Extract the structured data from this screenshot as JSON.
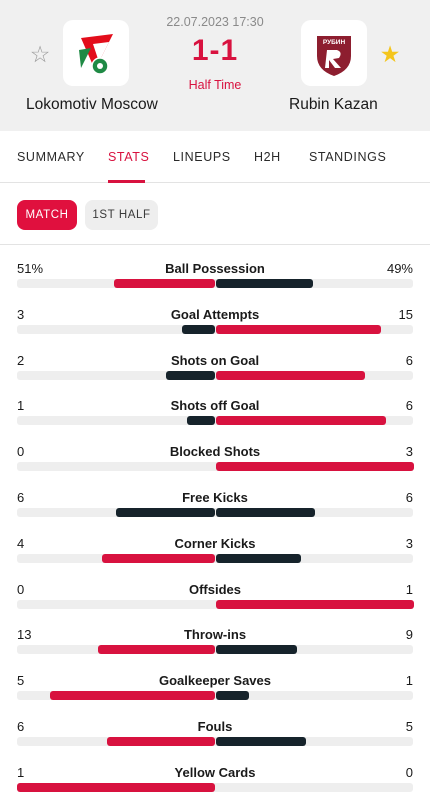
{
  "match": {
    "datetime": "22.07.2023 17:30",
    "score": "1-1",
    "status": "Half Time",
    "home": {
      "name": "Lokomotiv Moscow",
      "favorite": false
    },
    "away": {
      "name": "Rubin Kazan",
      "favorite": true,
      "logo_text": "РУБИН"
    }
  },
  "tabs": [
    {
      "label": "SUMMARY",
      "active": false
    },
    {
      "label": "STATS",
      "active": true
    },
    {
      "label": "LINEUPS",
      "active": false
    },
    {
      "label": "H2H",
      "active": false
    },
    {
      "label": "STANDINGS",
      "active": false
    }
  ],
  "periods": [
    {
      "label": "MATCH",
      "active": true
    },
    {
      "label": "1ST HALF",
      "active": false
    }
  ],
  "stats": [
    {
      "label": "Ball Possession",
      "home": "51%",
      "away": "49%",
      "home_value": 51,
      "away_value": 49
    },
    {
      "label": "Goal Attempts",
      "home": "3",
      "away": "15",
      "home_value": 3,
      "away_value": 15
    },
    {
      "label": "Shots on Goal",
      "home": "2",
      "away": "6",
      "home_value": 2,
      "away_value": 6
    },
    {
      "label": "Shots off Goal",
      "home": "1",
      "away": "6",
      "home_value": 1,
      "away_value": 6
    },
    {
      "label": "Blocked Shots",
      "home": "0",
      "away": "3",
      "home_value": 0,
      "away_value": 3
    },
    {
      "label": "Free Kicks",
      "home": "6",
      "away": "6",
      "home_value": 6,
      "away_value": 6
    },
    {
      "label": "Corner Kicks",
      "home": "4",
      "away": "3",
      "home_value": 4,
      "away_value": 3
    },
    {
      "label": "Offsides",
      "home": "0",
      "away": "1",
      "home_value": 0,
      "away_value": 1
    },
    {
      "label": "Throw-ins",
      "home": "13",
      "away": "9",
      "home_value": 13,
      "away_value": 9
    },
    {
      "label": "Goalkeeper Saves",
      "home": "5",
      "away": "1",
      "home_value": 5,
      "away_value": 1
    },
    {
      "label": "Fouls",
      "home": "6",
      "away": "5",
      "home_value": 6,
      "away_value": 5
    },
    {
      "label": "Yellow Cards",
      "home": "1",
      "away": "0",
      "home_value": 1,
      "away_value": 0
    }
  ],
  "colors": {
    "accent": "#d8123f",
    "dark": "#16232b",
    "track": "#eeeeee",
    "star_active": "#f4c51c",
    "star_inactive": "#9a9a9a",
    "lokomotiv_red": "#e30d1b",
    "lokomotiv_green": "#1f8a45",
    "rubin_maroon": "#8d1e2f"
  },
  "icons": {
    "favorite": "star-icon"
  }
}
